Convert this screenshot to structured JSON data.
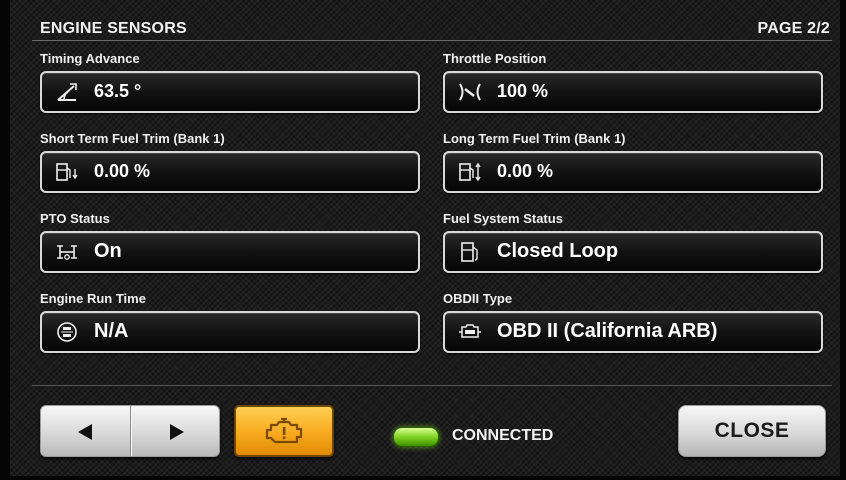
{
  "header": {
    "title": "ENGINE SENSORS",
    "page": "PAGE 2/2"
  },
  "sensors": [
    {
      "label": "Timing Advance",
      "value": "63.5 °",
      "icon": "timing-advance-icon"
    },
    {
      "label": "Throttle Position",
      "value": "100 %",
      "icon": "throttle-icon"
    },
    {
      "label": "Short Term Fuel Trim (Bank 1)",
      "value": "0.00 %",
      "icon": "fuel-trim-short-icon"
    },
    {
      "label": "Long Term Fuel Trim (Bank 1)",
      "value": "0.00 %",
      "icon": "fuel-trim-long-icon"
    },
    {
      "label": "PTO Status",
      "value": "On",
      "icon": "pto-icon"
    },
    {
      "label": "Fuel System Status",
      "value": "Closed Loop",
      "icon": "fuel-pump-icon"
    },
    {
      "label": "Engine Run Time",
      "value": "N/A",
      "icon": "run-time-icon"
    },
    {
      "label": "OBDII Type",
      "value": "OBD II (California ARB)",
      "icon": "obd-icon"
    }
  ],
  "footer": {
    "status": "CONNECTED",
    "close_label": "CLOSE",
    "engine_icon": "check-engine-icon",
    "led_color": "#7ed321",
    "engine_button_color": "#f7a91f"
  }
}
